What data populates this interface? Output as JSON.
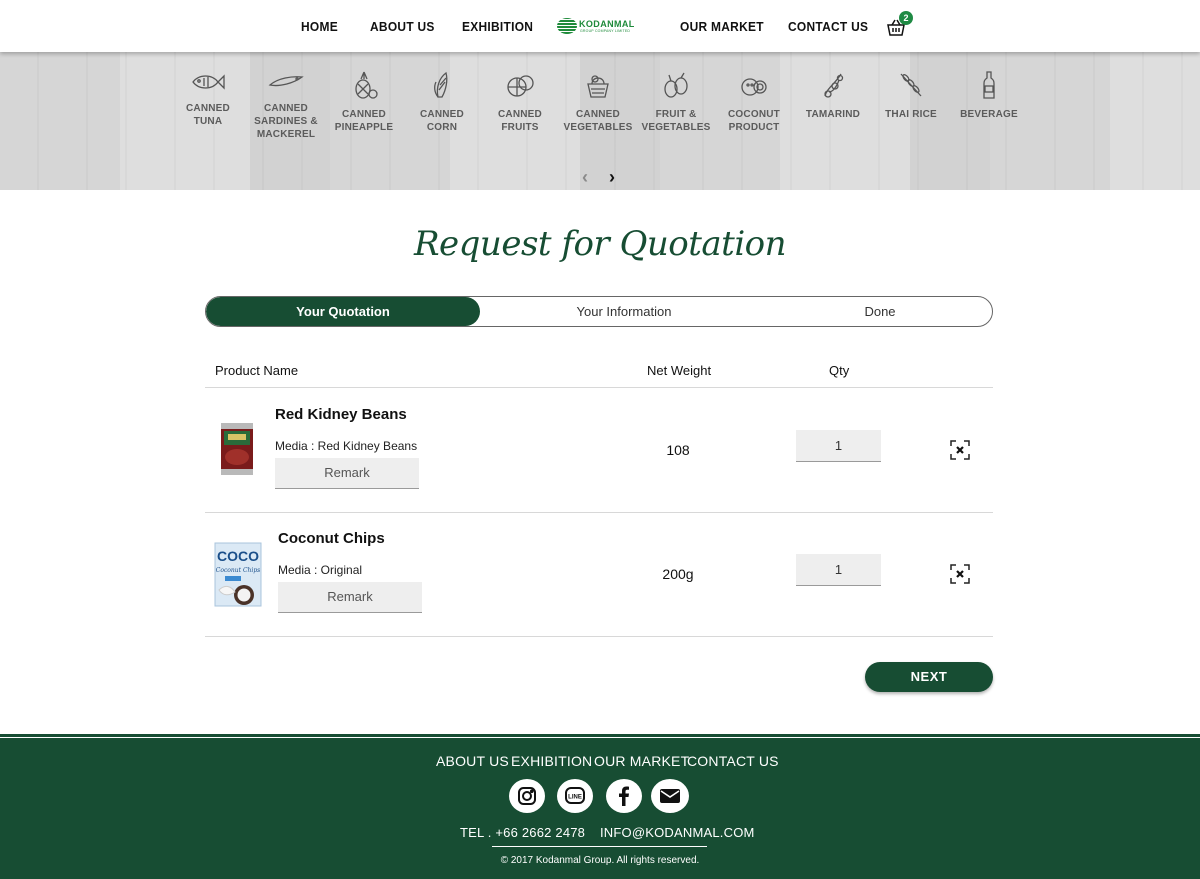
{
  "nav": {
    "home": "HOME",
    "about": "ABOUT US",
    "exhibition": "EXHIBITION",
    "logo_text": "KODANMAL",
    "logo_sub": "GROUP COMPANY LIMITED",
    "market": "OUR MARKET",
    "contact": "CONTACT US",
    "cart_icon": "basket-icon",
    "cart_count": "2"
  },
  "categories": [
    {
      "label": "CANNED\nTUNA",
      "icon": "fish-icon"
    },
    {
      "label": "CANNED\nSARDINES &\nMACKEREL",
      "icon": "sardine-icon"
    },
    {
      "label": "CANNED\nPINEAPPLE",
      "icon": "pineapple-icon"
    },
    {
      "label": "CANNED\nCORN",
      "icon": "corn-icon"
    },
    {
      "label": "CANNED\nFRUITS",
      "icon": "fruit-icon"
    },
    {
      "label": "CANNED\nVEGETABLES",
      "icon": "vegetable-basket-icon"
    },
    {
      "label": "FRUIT &\nVEGETABLES",
      "icon": "produce-icon"
    },
    {
      "label": "COCONUT\nPRODUCT",
      "icon": "coconut-icon"
    },
    {
      "label": "TAMARIND",
      "icon": "tamarind-icon"
    },
    {
      "label": "THAI RICE",
      "icon": "rice-icon"
    },
    {
      "label": "BEVERAGE",
      "icon": "bottle-icon"
    }
  ],
  "carousel": {
    "prev": "‹",
    "next": "›"
  },
  "page_title": "Request for Quotation",
  "steps": [
    "Your Quotation",
    "Your Information",
    "Done"
  ],
  "table": {
    "headers": {
      "product": "Product Name",
      "weight": "Net Weight",
      "qty": "Qty"
    },
    "rows": [
      {
        "name": "Red Kidney Beans",
        "media": "Media : Red Kidney Beans",
        "remark": "Remark",
        "weight": "108",
        "qty": "1"
      },
      {
        "name": "Coconut Chips",
        "media": "Media : Original",
        "remark": "Remark",
        "weight": "200g",
        "qty": "1"
      }
    ]
  },
  "next_label": "NEXT",
  "footer": {
    "links": [
      "ABOUT US",
      "EXHIBITION",
      "OUR MARKET",
      "CONTACT US"
    ],
    "social": [
      "instagram-icon",
      "line-icon",
      "facebook-icon",
      "email-icon"
    ],
    "tel": "TEL . +66 2662 2478",
    "email": "INFO@KODANMAL.COM",
    "copyright": "© 2017 Kodanmal Group. All rights reserved."
  },
  "colors": {
    "brand_green": "#174d33",
    "badge_green": "#1f8a44"
  }
}
